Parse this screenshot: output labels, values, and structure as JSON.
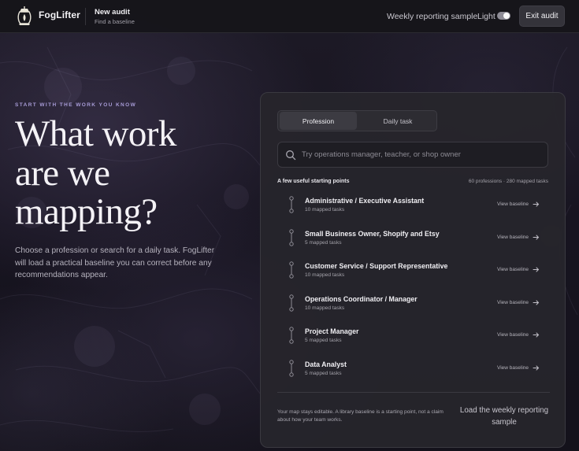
{
  "header": {
    "brand": "FogLifter",
    "audit_title": "New audit",
    "audit_subtitle": "Find a baseline",
    "weekly_link": "Weekly reporting sample",
    "theme_label": "Light",
    "theme_toggle_on": true,
    "exit_label": "Exit audit"
  },
  "hero": {
    "eyebrow": "START WITH THE WORK YOU KNOW",
    "headline_line1": "What work",
    "headline_line2": "are we",
    "headline_line3": "mapping?",
    "lede": "Choose a profession or search for a daily task. FogLifter will load a practical baseline you can correct before any recommendations appear."
  },
  "panel": {
    "tabs": [
      {
        "label": "Profession",
        "selected": true
      },
      {
        "label": "Daily task",
        "selected": false
      }
    ],
    "search": {
      "placeholder": "Try operations manager, teacher, or shop owner",
      "value": ""
    },
    "list_heading": "A few useful starting points",
    "list_count": "60 professions · 280 mapped tasks",
    "items": [
      {
        "title": "Administrative / Executive Assistant",
        "tasks": "10 mapped tasks",
        "link": "View baseline"
      },
      {
        "title": "Small Business Owner, Shopify and Etsy",
        "tasks": "5 mapped tasks",
        "link": "View baseline"
      },
      {
        "title": "Customer Service / Support Representative",
        "tasks": "10 mapped tasks",
        "link": "View baseline"
      },
      {
        "title": "Operations Coordinator / Manager",
        "tasks": "10 mapped tasks",
        "link": "View baseline"
      },
      {
        "title": "Project Manager",
        "tasks": "5 mapped tasks",
        "link": "View baseline"
      },
      {
        "title": "Data Analyst",
        "tasks": "5 mapped tasks",
        "link": "View baseline"
      }
    ],
    "footer_note": "Your map stays editable. A library baseline is a starting point, not a claim about how your team works.",
    "load_link": "Load the weekly reporting sample"
  },
  "icons": {
    "logo": "lantern-logo-icon",
    "search": "search-icon",
    "row": "timeline-pin-icon",
    "arrow": "arrow-right-icon"
  },
  "colors": {
    "accent": "#a79bd6",
    "panel": "#26252b",
    "text": "#f0eff3",
    "muted": "#a5a3ab"
  }
}
